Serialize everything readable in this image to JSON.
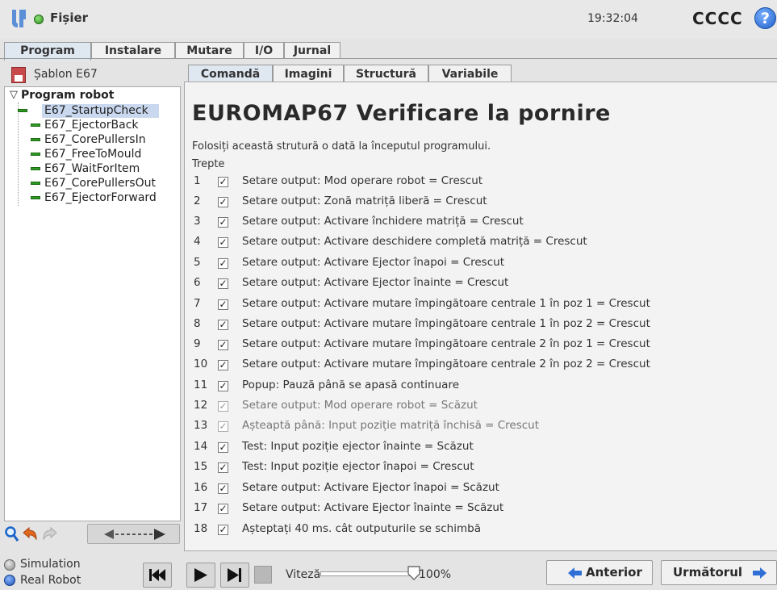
{
  "header": {
    "file_menu": "Fișier",
    "clock": "19:32:04",
    "robot_name": "CCCC",
    "help": "?"
  },
  "main_tabs": [
    {
      "label": "Program"
    },
    {
      "label": "Instalare"
    },
    {
      "label": "Mutare"
    },
    {
      "label": "I/O"
    },
    {
      "label": "Jurnal"
    }
  ],
  "left_panel": {
    "template_label": "Șablon E67",
    "tree_root": "Program robot",
    "tree_items": [
      {
        "label": "E67_StartupCheck"
      },
      {
        "label": "E67_EjectorBack"
      },
      {
        "label": "E67_CorePullersIn"
      },
      {
        "label": "E67_FreeToMould"
      },
      {
        "label": "E67_WaitForItem"
      },
      {
        "label": "E67_CorePullersOut"
      },
      {
        "label": "E67_EjectorForward"
      }
    ]
  },
  "sub_tabs": [
    {
      "label": "Comandă"
    },
    {
      "label": "Imagini"
    },
    {
      "label": "Structură"
    },
    {
      "label": "Variabile"
    }
  ],
  "content": {
    "title": "EUROMAP67 Verificare la pornire",
    "description": "Folosiți această strutură o dată la începutul programului.",
    "steps_label": "Trepte",
    "steps": [
      {
        "num": "1",
        "text": "Setare output: Mod operare robot = Crescut"
      },
      {
        "num": "2",
        "text": "Setare output: Zonă matriță liberă = Crescut"
      },
      {
        "num": "3",
        "text": "Setare output: Activare închidere matriță = Crescut"
      },
      {
        "num": "4",
        "text": "Setare output: Activare deschidere completă matriță = Crescut"
      },
      {
        "num": "5",
        "text": "Setare output: Activare Ejector înapoi = Crescut"
      },
      {
        "num": "6",
        "text": "Setare output: Activare Ejector înainte = Crescut"
      },
      {
        "num": "7",
        "text": "Setare output: Activare mutare împingătoare centrale 1 în poz 1 = Crescut"
      },
      {
        "num": "8",
        "text": "Setare output: Activare mutare împingătoare centrale 1 în poz 2 = Crescut"
      },
      {
        "num": "9",
        "text": "Setare output: Activare mutare împingătoare centrale 2 în poz 1 = Crescut"
      },
      {
        "num": "10",
        "text": "Setare output: Activare mutare împingătoare centrale 2 în poz 2 = Crescut"
      },
      {
        "num": "11",
        "text": "Popup: Pauză până se apasă continuare"
      },
      {
        "num": "12",
        "text": "Setare output: Mod operare robot = Scăzut"
      },
      {
        "num": "13",
        "text": "Așteaptă până: Input poziție matriță închisă = Crescut"
      },
      {
        "num": "14",
        "text": "Test: Input poziție ejector înainte = Scăzut"
      },
      {
        "num": "15",
        "text": "Test: Input poziție ejector înapoi = Crescut"
      },
      {
        "num": "16",
        "text": "Setare output: Activare Ejector înapoi = Scăzut"
      },
      {
        "num": "17",
        "text": "Setare output: Activare Ejector înainte = Scăzut"
      },
      {
        "num": "18",
        "text": "Așteptați 40 ms. cât outputurile se schimbă"
      }
    ]
  },
  "bottom": {
    "simulation_label": "Simulation",
    "real_robot_label": "Real Robot",
    "speed_label": "Viteză",
    "speed_value": "100%",
    "prev_label": "Anterior",
    "next_label": "Următorul"
  }
}
